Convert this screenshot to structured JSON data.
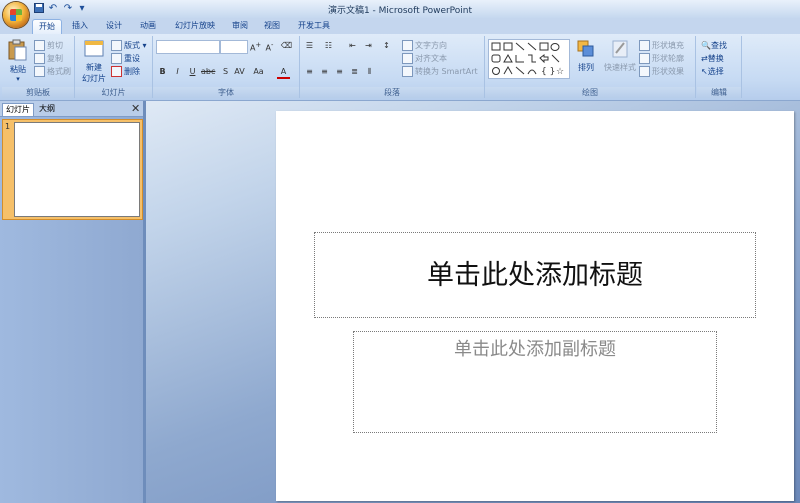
{
  "window": {
    "title": "演示文稿1 - Microsoft PowerPoint"
  },
  "qat": [
    "save-icon",
    "undo-icon",
    "redo-icon",
    "qat-dropdown-icon"
  ],
  "tabs": [
    {
      "label": "开始",
      "active": true
    },
    {
      "label": "插入"
    },
    {
      "label": "设计"
    },
    {
      "label": "动画"
    },
    {
      "label": "幻灯片放映"
    },
    {
      "label": "审阅"
    },
    {
      "label": "视图"
    },
    {
      "label": "开发工具"
    }
  ],
  "ribbon": {
    "clipboard": {
      "label": "剪贴板",
      "paste": "粘贴",
      "cut": "剪切",
      "copy": "复制",
      "format_painter": "格式刷"
    },
    "slides": {
      "label": "幻灯片",
      "new_slide_1": "新建",
      "new_slide_2": "幻灯片",
      "layout": "版式",
      "reset": "重设",
      "delete": "删除"
    },
    "font": {
      "label": "字体",
      "font_name": "",
      "font_size": ""
    },
    "paragraph": {
      "label": "段落",
      "text_direction": "文字方向",
      "align_text": "对齐文本",
      "smartart": "转换为 SmartArt"
    },
    "drawing": {
      "label": "绘图",
      "arrange": "排列",
      "quick_styles": "快速样式",
      "shape_fill": "形状填充",
      "shape_outline": "形状轮廓",
      "shape_effects": "形状效果"
    },
    "editing": {
      "label": "编辑",
      "find": "查找",
      "replace": "替换",
      "select": "选择"
    }
  },
  "left_pane": {
    "tab_slides": "幻灯片",
    "tab_outline": "大纲",
    "slide_number": "1"
  },
  "slide": {
    "title_placeholder": "单击此处添加标题",
    "subtitle_placeholder": "单击此处添加副标题"
  },
  "colors": {
    "accent": "#15428b",
    "ribbon_bg": "#c6daf3",
    "workspace": "#6b88b9",
    "selected_thumb": "#f6c069"
  }
}
